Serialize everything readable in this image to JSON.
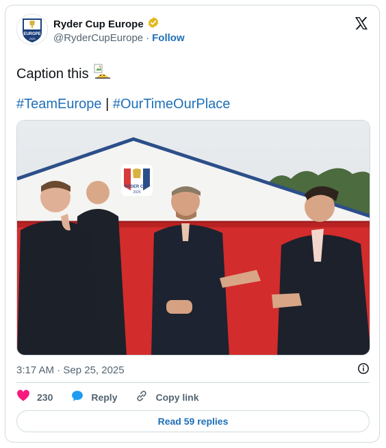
{
  "account": {
    "name": "Ryder Cup Europe",
    "handle": "@RyderCupEurope",
    "separator": "·",
    "follow_label": "Follow",
    "verified_icon": "gold-verified-badge",
    "avatar_text": "EUROPE",
    "avatar_year": "2025"
  },
  "tweet": {
    "caption": "Caption this",
    "hashtag_1": "#TeamEurope",
    "hashtag_sep": "|",
    "hashtag_2": "#OurTimeOurPlace",
    "timestamp": "3:17 AM · Sep 25, 2025"
  },
  "photo": {
    "banner_text": "RYDER CUP",
    "banner_year": "2025"
  },
  "actions": {
    "likes": "230",
    "reply_label": "Reply",
    "copy_link_label": "Copy link",
    "read_replies_label": "Read 59 replies"
  },
  "colors": {
    "accent": "#1d6fb8",
    "like": "#f91880",
    "verified_gold": "#e2b719",
    "text_secondary": "#536471"
  }
}
